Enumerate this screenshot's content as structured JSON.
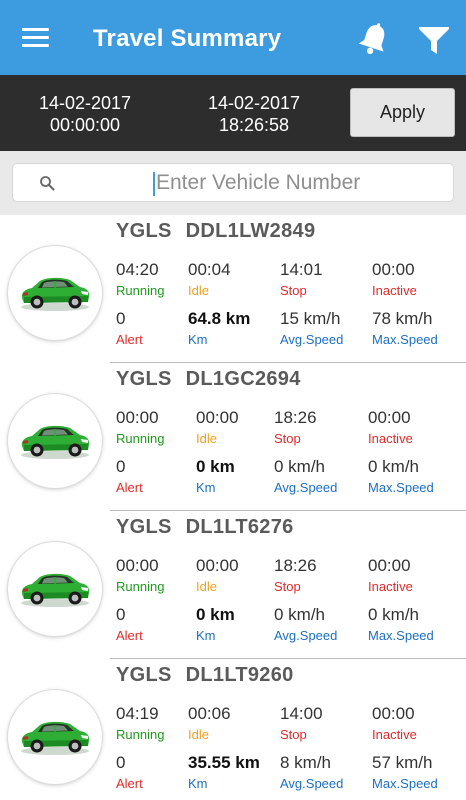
{
  "header": {
    "title": "Travel Summary",
    "icons": [
      "menu-icon",
      "bell-icon",
      "filter-icon"
    ],
    "color": "#3d9be0"
  },
  "date_range": {
    "from_date": "14-02-2017",
    "from_time": "00:00:00",
    "to_date": "14-02-2017",
    "to_time": "18:26:58",
    "apply_label": "Apply"
  },
  "search": {
    "placeholder": "Enter Vehicle Number",
    "value": ""
  },
  "labels": {
    "running": "Running",
    "idle": "Idle",
    "stop": "Stop",
    "inactive": "Inactive",
    "alert": "Alert",
    "km": "Km",
    "avg_speed": "Avg.Speed",
    "max_speed": "Max.Speed"
  },
  "label_colors": {
    "running": "#1f9a1f",
    "idle": "#f2a01e",
    "stop": "#e02b2b",
    "inactive": "#e02b2b",
    "alert": "#e02b2b",
    "km": "#1c6fc2",
    "avg_speed": "#1c6fc2",
    "max_speed": "#1c6fc2"
  },
  "vehicles": [
    {
      "prefix": "YGLS",
      "number": "DDL1LW2849",
      "running": "04:20",
      "idle": "00:04",
      "stop": "14:01",
      "inactive": "00:00",
      "alert": "0",
      "km": "64.8 km",
      "avg_speed": "15 km/h",
      "max_speed": "78 km/h"
    },
    {
      "prefix": "YGLS",
      "number": "DL1GC2694",
      "running": "00:00",
      "idle": "00:00",
      "stop": "18:26",
      "inactive": "00:00",
      "alert": "0",
      "km": "0 km",
      "avg_speed": "0 km/h",
      "max_speed": "0 km/h"
    },
    {
      "prefix": "YGLS",
      "number": "DL1LT6276",
      "running": "00:00",
      "idle": "00:00",
      "stop": "18:26",
      "inactive": "00:00",
      "alert": "0",
      "km": "0 km",
      "avg_speed": "0 km/h",
      "max_speed": "0 km/h"
    },
    {
      "prefix": "YGLS",
      "number": "DL1LT9260",
      "running": "04:19",
      "idle": "00:06",
      "stop": "14:00",
      "inactive": "00:00",
      "alert": "0",
      "km": "35.55 km",
      "avg_speed": "8 km/h",
      "max_speed": "57 km/h"
    }
  ]
}
